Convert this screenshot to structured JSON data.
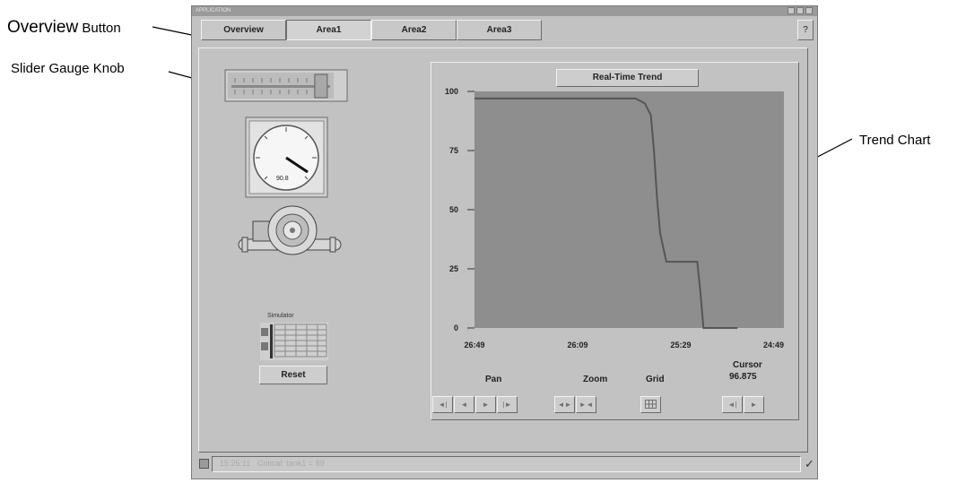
{
  "callouts": {
    "overview_label_a": "Overview",
    "overview_label_b": " Button",
    "slider_gauge_knob": "Slider Gauge Knob",
    "trend_chart": "Trend Chart"
  },
  "window": {
    "title": "APPLICATION",
    "help": "?"
  },
  "tabs": [
    {
      "label": "Overview"
    },
    {
      "label": "Area1"
    },
    {
      "label": "Area2"
    },
    {
      "label": "Area3"
    }
  ],
  "gauge": {
    "value_text": "90.8",
    "level": 0.908
  },
  "simulator": {
    "label": "Simulator",
    "reset": "Reset"
  },
  "trend": {
    "title": "Real-Time Trend",
    "pan": "Pan",
    "zoom": "Zoom",
    "grid": "Grid",
    "cursor_label": "Cursor",
    "cursor_value": "96.875"
  },
  "chart_data": {
    "type": "line",
    "title": "Real-Time Trend",
    "xticks": [
      "26:49",
      "26:09",
      "25:29",
      "24:49"
    ],
    "yticks": [
      100,
      75,
      50,
      25,
      0
    ],
    "ylim": [
      0,
      100
    ],
    "series": [
      {
        "x": [
          0,
          0.52,
          0.55,
          0.57,
          0.58,
          0.59,
          0.6,
          0.62,
          0.64,
          0.65,
          0.66,
          0.67,
          0.69,
          0.72,
          0.73,
          0.74,
          0.75,
          0.78,
          0.85
        ],
        "values": [
          97,
          97,
          95,
          90,
          75,
          55,
          40,
          28,
          28,
          28,
          28,
          28,
          28,
          28,
          15,
          0,
          0,
          0,
          0
        ]
      }
    ]
  },
  "status": {
    "message": "15:25:11   Critical: tank1 = 89",
    "check": "✓"
  }
}
